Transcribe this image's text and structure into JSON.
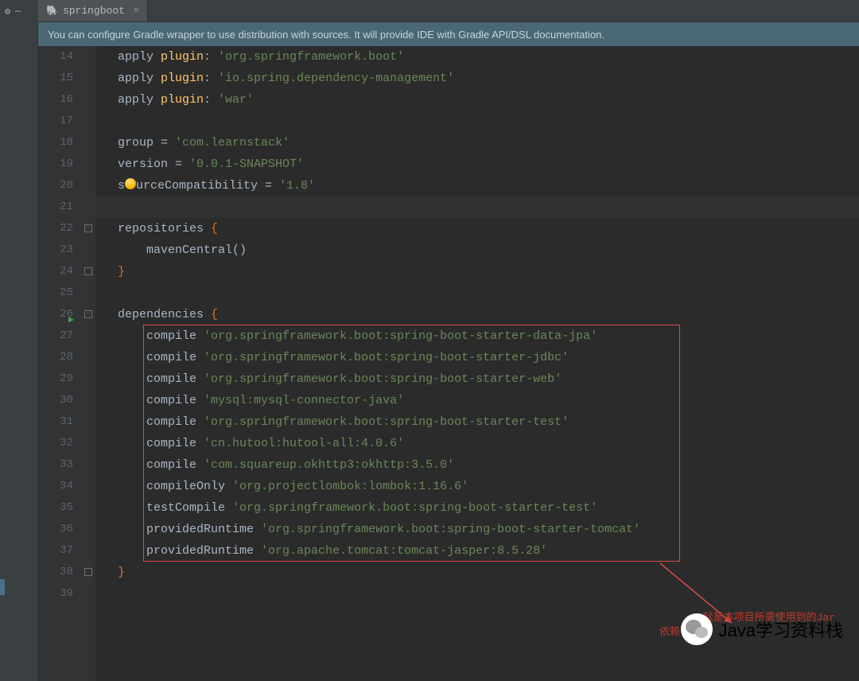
{
  "topbar": {
    "gear": "⚙",
    "minus": "—"
  },
  "tab": {
    "icon": "🐘",
    "label": "springboot",
    "close": "×"
  },
  "notification": "You can configure Gradle wrapper to use distribution with sources. It will provide IDE with Gradle API/DSL documentation.",
  "gutter": {
    "start": 14,
    "end": 39
  },
  "code": {
    "lines": [
      {
        "n": 14,
        "segs": [
          [
            "ident",
            "apply "
          ],
          [
            "yellow",
            "plugin"
          ],
          [
            "ident",
            ": "
          ],
          [
            "str",
            "'org.springframework.boot'"
          ]
        ]
      },
      {
        "n": 15,
        "segs": [
          [
            "ident",
            "apply "
          ],
          [
            "yellow",
            "plugin"
          ],
          [
            "ident",
            ": "
          ],
          [
            "str",
            "'io.spring.dependency-management'"
          ]
        ]
      },
      {
        "n": 16,
        "segs": [
          [
            "ident",
            "apply "
          ],
          [
            "yellow",
            "plugin"
          ],
          [
            "ident",
            ": "
          ],
          [
            "str",
            "'war'"
          ]
        ]
      },
      {
        "n": 17,
        "segs": []
      },
      {
        "n": 18,
        "segs": [
          [
            "ident",
            "group = "
          ],
          [
            "str",
            "'com.learnstack'"
          ]
        ]
      },
      {
        "n": 19,
        "segs": [
          [
            "ident",
            "version = "
          ],
          [
            "str",
            "'0.0.1-SNAPSHOT'"
          ]
        ]
      },
      {
        "n": 20,
        "segs": [
          [
            "ident",
            "s"
          ],
          [
            "bulb",
            ""
          ],
          [
            "ident",
            "urceCompatibility = "
          ],
          [
            "str",
            "'1.8'"
          ]
        ]
      },
      {
        "n": 21,
        "highlight": true,
        "segs": []
      },
      {
        "n": 22,
        "fold": "-",
        "segs": [
          [
            "ident",
            "repositories "
          ],
          [
            "kw",
            "{"
          ]
        ]
      },
      {
        "n": 23,
        "indent": 1,
        "segs": [
          [
            "ident",
            "mavenCentral()"
          ]
        ]
      },
      {
        "n": 24,
        "fold": "e",
        "segs": [
          [
            "kw",
            "}"
          ]
        ]
      },
      {
        "n": 25,
        "segs": []
      },
      {
        "n": 26,
        "run": true,
        "fold": "-",
        "segs": [
          [
            "ident",
            "dependencies "
          ],
          [
            "kw",
            "{"
          ]
        ]
      },
      {
        "n": 27,
        "indent": 1,
        "segs": [
          [
            "ident",
            "compile "
          ],
          [
            "str",
            "'org.springframework.boot:spring-boot-starter-data-jpa'"
          ]
        ]
      },
      {
        "n": 28,
        "indent": 1,
        "segs": [
          [
            "ident",
            "compile "
          ],
          [
            "str",
            "'org.springframework.boot:spring-boot-starter-jdbc'"
          ]
        ]
      },
      {
        "n": 29,
        "indent": 1,
        "segs": [
          [
            "ident",
            "compile "
          ],
          [
            "str",
            "'org.springframework.boot:spring-boot-starter-web'"
          ]
        ]
      },
      {
        "n": 30,
        "indent": 1,
        "segs": [
          [
            "ident",
            "compile "
          ],
          [
            "str",
            "'mysql:mysql-connector-java'"
          ]
        ]
      },
      {
        "n": 31,
        "indent": 1,
        "segs": [
          [
            "ident",
            "compile "
          ],
          [
            "str",
            "'org.springframework.boot:spring-boot-starter-test'"
          ]
        ]
      },
      {
        "n": 32,
        "indent": 1,
        "segs": [
          [
            "ident",
            "compile "
          ],
          [
            "str",
            "'cn.hutool:hutool-all:4.0.6'"
          ]
        ]
      },
      {
        "n": 33,
        "indent": 1,
        "segs": [
          [
            "ident",
            "compile "
          ],
          [
            "str",
            "'com.squareup.okhttp3:okhttp:3.5.0'"
          ]
        ]
      },
      {
        "n": 34,
        "indent": 1,
        "segs": [
          [
            "ident",
            "compileOnly "
          ],
          [
            "str",
            "'org.projectlombok:lombok:1.16.6'"
          ]
        ]
      },
      {
        "n": 35,
        "indent": 1,
        "segs": [
          [
            "ident",
            "testCompile "
          ],
          [
            "str",
            "'org.springframework.boot:spring-boot-starter-test'"
          ]
        ]
      },
      {
        "n": 36,
        "indent": 1,
        "segs": [
          [
            "ident",
            "providedRuntime "
          ],
          [
            "str",
            "'org.springframework.boot:spring-boot-starter-tomcat'"
          ]
        ]
      },
      {
        "n": 37,
        "indent": 1,
        "segs": [
          [
            "ident",
            "providedRuntime "
          ],
          [
            "str",
            "'org.apache.tomcat:tomcat-jasper:8.5.28'"
          ]
        ]
      },
      {
        "n": 38,
        "fold": "e",
        "segs": [
          [
            "kw",
            "}"
          ]
        ]
      },
      {
        "n": 39,
        "segs": []
      }
    ]
  },
  "redLabel1": "就是本项目所需使用到的Jar",
  "redLabel2": "依赖",
  "watermark": "Java学习资料栈"
}
